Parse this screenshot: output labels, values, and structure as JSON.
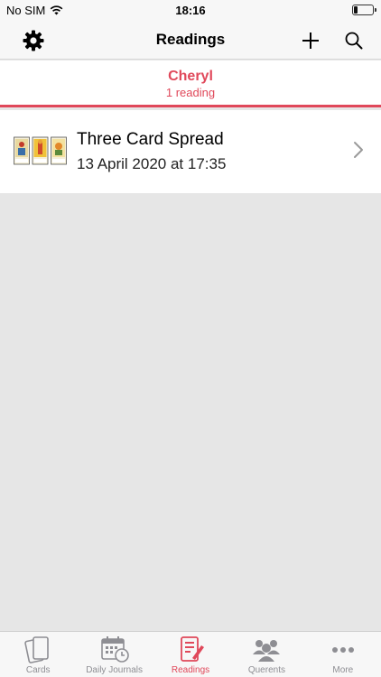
{
  "status_bar": {
    "carrier": "No SIM",
    "time": "18:16",
    "battery_level": 0.2
  },
  "nav": {
    "title": "Readings",
    "settings_icon": "gear-icon",
    "add_icon": "plus-icon",
    "search_icon": "search-icon"
  },
  "querent": {
    "name": "Cheryl",
    "count_label": "1 reading"
  },
  "readings": [
    {
      "title": "Three Card Spread",
      "date": "13 April 2020 at 17:35"
    }
  ],
  "tabs": [
    {
      "label": "Cards",
      "icon": "cards-icon",
      "active": false
    },
    {
      "label": "Daily Journals",
      "icon": "calendar-clock-icon",
      "active": false
    },
    {
      "label": "Readings",
      "icon": "readings-icon",
      "active": true
    },
    {
      "label": "Querents",
      "icon": "people-icon",
      "active": false
    },
    {
      "label": "More",
      "icon": "more-icon",
      "active": false
    }
  ],
  "colors": {
    "accent": "#e0485a",
    "inactive": "#8e8e93",
    "background": "#e6e6e6"
  }
}
